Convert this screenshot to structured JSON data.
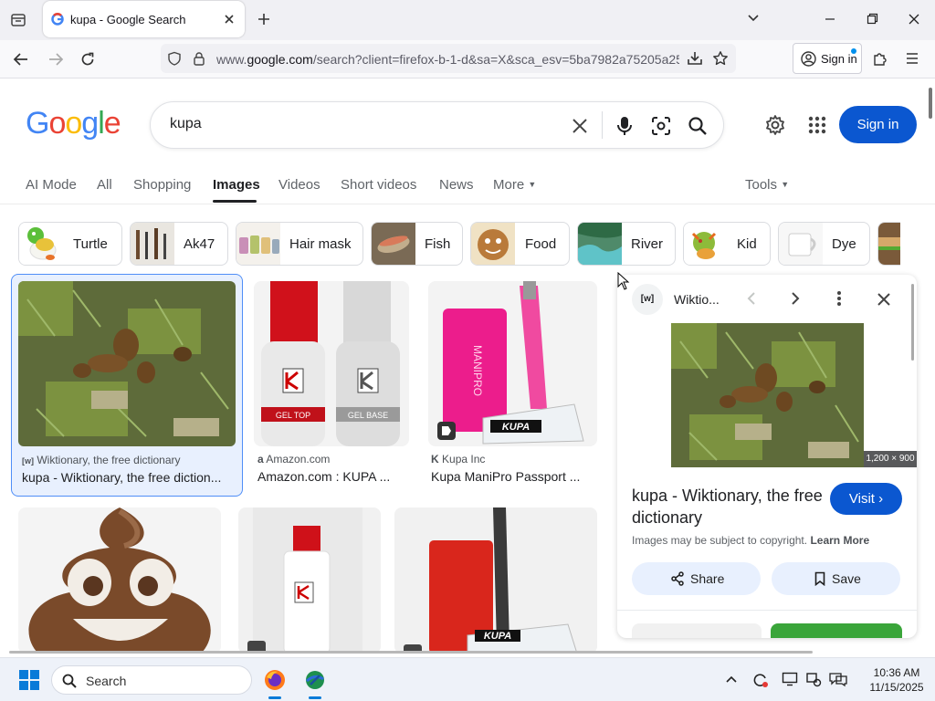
{
  "browser": {
    "tab_title": "kupa - Google Search",
    "url_prefix": "www.",
    "url_domain": "google.com",
    "url_rest": "/search?client=firefox-b-1-d&sa=X&sca_esv=5ba7982a75205a25",
    "sign_in": "Sign in"
  },
  "google": {
    "logo": [
      "G",
      "o",
      "o",
      "g",
      "l",
      "e"
    ],
    "logo_colors": [
      "#4285f4",
      "#ea4335",
      "#fbbc05",
      "#4285f4",
      "#34a853",
      "#ea4335"
    ],
    "query": "kupa",
    "sign_in": "Sign in"
  },
  "nav": {
    "tabs": [
      "AI Mode",
      "All",
      "Shopping",
      "Images",
      "Videos",
      "Short videos",
      "News",
      "More"
    ],
    "active": "Images",
    "tools": "Tools"
  },
  "chips": [
    "Turtle",
    "Ak47",
    "Hair mask",
    "Fish",
    "Food",
    "River",
    "Kid",
    "Dye"
  ],
  "results": [
    {
      "source": "Wiktionary, the free dictionary",
      "title": "kupa - Wiktionary, the free diction..."
    },
    {
      "source": "Amazon.com",
      "title": "Amazon.com : KUPA ..."
    },
    {
      "source": "Kupa Inc",
      "title": "Kupa ManiPro Passport ..."
    }
  ],
  "product_labels": {
    "bottle1": "GEL TOP",
    "bottle2": "GEL BASE",
    "device": "KUPA",
    "device_side": "MANIPRO"
  },
  "panel": {
    "site": "Wiktio...",
    "dimensions": "1,200 × 900",
    "title": "kupa - Wiktionary, the free dictionary",
    "visit": "Visit",
    "copyright": "Images may be subject to copyright.",
    "learn_more": "Learn More",
    "share": "Share",
    "save": "Save"
  },
  "taskbar": {
    "search": "Search",
    "time": "10:36 AM",
    "date": "11/15/2025"
  },
  "colors": {
    "accent": "#0b57d0",
    "chip_border": "#dadce0",
    "selected_card": "#d2e3fc"
  }
}
